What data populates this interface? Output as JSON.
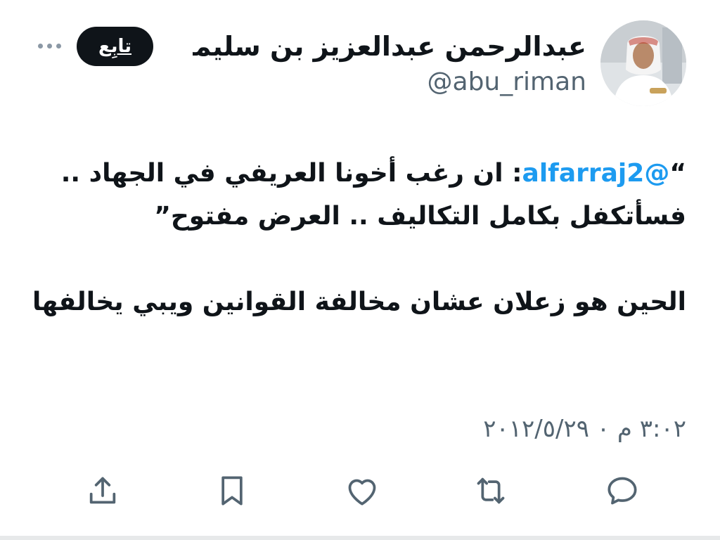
{
  "author": {
    "display_name": "عبدالرحمن عبدالعزيز بن سليمان",
    "handle": "@abu_riman",
    "avatar_icon": "profile-photo"
  },
  "header": {
    "follow_label": "تابِع",
    "more_icon": "more-dots-icon"
  },
  "tweet": {
    "quote_open": "“",
    "mention": "@alfarraj2",
    "quote_body": ": ان رغب أخونا العريفي في الجهاد .. فسأتكفل بكامل التكاليف .. العرض مفتوح”",
    "reply": "الحين هو زعلان عشان مخالفة القوانين ويبي يخالفها"
  },
  "timestamp": "٣:٠٢ م ٠ ٢٠١٢/٥/٢٩",
  "actions": {
    "reply_icon": "comment-icon",
    "retweet_icon": "retweet-icon",
    "like_icon": "heart-icon",
    "bookmark_icon": "bookmark-icon",
    "share_icon": "share-icon"
  },
  "colors": {
    "mention": "#1d9bf0",
    "secondary_text": "#536471",
    "follow_bg": "#0f1419"
  }
}
